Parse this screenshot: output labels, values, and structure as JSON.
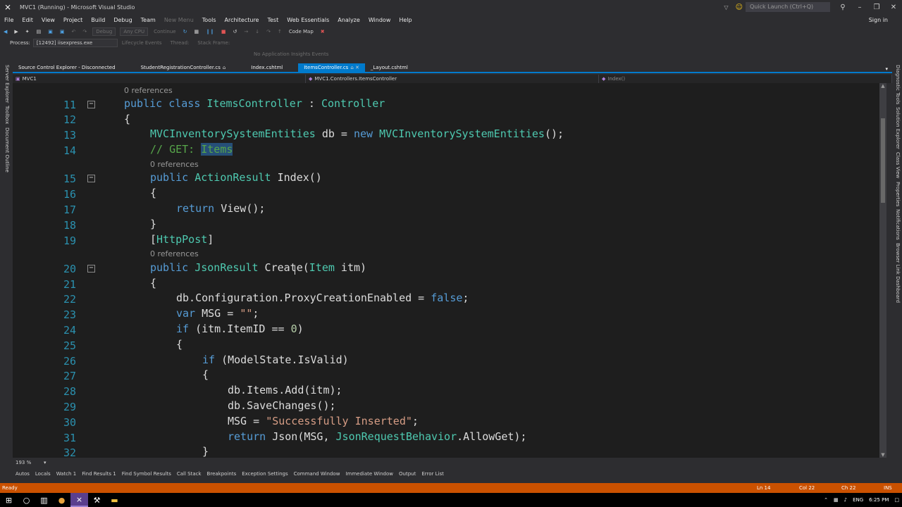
{
  "window": {
    "title": "MVC1 (Running) - Microsoft Visual Studio",
    "quick_launch": "Quick Launch (Ctrl+Q)",
    "sign_in": "Sign in"
  },
  "menu": [
    "File",
    "Edit",
    "View",
    "Project",
    "Build",
    "Debug",
    "Team",
    "New Menu",
    "Tools",
    "Architecture",
    "Test",
    "Web Essentials",
    "Analyze",
    "Window",
    "Help"
  ],
  "toolbar": {
    "debug_combo": "Debug",
    "cpu_combo": "Any CPU",
    "continue": "Continue",
    "code_map": "Code Map"
  },
  "debug_toolbar": {
    "process_label": "Process:",
    "process_value": "[12492] iisexpress.exe",
    "lifecycle": "Lifecycle Events",
    "thread": "Thread:",
    "stack_frame": "Stack Frame:",
    "insights": "No Application Insights Events"
  },
  "left_rail": [
    "Server Explorer",
    "Toolbox",
    "Document Outline"
  ],
  "right_rail": [
    "Diagnostic Tools",
    "Solution Explorer",
    "Class View",
    "Properties",
    "Notifications",
    "Browser Link Dashboard"
  ],
  "doc_tabs": [
    {
      "label": "Source Control Explorer - Disconnected",
      "pin": ""
    },
    {
      "label": "StudentRegistrationController.cs",
      "pin": "⌂"
    },
    {
      "label": "Index.cshtml",
      "pin": ""
    },
    {
      "label": "ItemsController.cs",
      "pin": "⌂ ✕"
    },
    {
      "label": "_Layout.cshtml",
      "pin": ""
    }
  ],
  "nav": {
    "project": "MVC1",
    "class": "MVC1.Controllers.ItemsController",
    "member": "Index()"
  },
  "refs_label": "0 references",
  "code": {
    "l11": {
      "n": "11",
      "a": "public",
      "b": "class",
      "c": "ItemsController",
      "d": ":",
      "e": "Controller"
    },
    "l12": {
      "n": "12",
      "t": "{"
    },
    "l13": {
      "n": "13",
      "a": "MVCInventorySystemEntities",
      "b": " db = ",
      "c": "new",
      "d": "MVCInventorySystemEntities",
      "e": "();"
    },
    "l14": {
      "n": "14",
      "a": "// GET: ",
      "b": "Items"
    },
    "l15": {
      "n": "15",
      "a": "public",
      "b": "ActionResult",
      "c": " Index()"
    },
    "l16": {
      "n": "16",
      "t": "{"
    },
    "l17": {
      "n": "17",
      "a": "return",
      "b": " View();"
    },
    "l18": {
      "n": "18",
      "t": "}"
    },
    "l19": {
      "n": "19",
      "a": "[",
      "b": "HttpPost",
      "c": "]"
    },
    "l20": {
      "n": "20",
      "a": "public",
      "b": "JsonResult",
      "c": " Create(",
      "d": "Item",
      "e": " itm)"
    },
    "l21": {
      "n": "21",
      "t": "{"
    },
    "l22": {
      "n": "22",
      "a": "db.Configuration.ProxyCreationEnabled = ",
      "b": "false",
      "c": ";"
    },
    "l23": {
      "n": "23",
      "a": "var",
      "b": " MSG = ",
      "c": "\"\"",
      "d": ";"
    },
    "l24": {
      "n": "24",
      "a": "if",
      "b": " (itm.ItemID == ",
      "c": "0",
      "d": ")"
    },
    "l25": {
      "n": "25",
      "t": "{"
    },
    "l26": {
      "n": "26",
      "a": "if",
      "b": " (ModelState.IsValid)"
    },
    "l27": {
      "n": "27",
      "t": "{"
    },
    "l28": {
      "n": "28",
      "t": "db.Items.Add(itm);"
    },
    "l29": {
      "n": "29",
      "t": "db.SaveChanges();"
    },
    "l30": {
      "n": "30",
      "a": "MSG = ",
      "b": "\"Successfully Inserted\"",
      "c": ";"
    },
    "l31": {
      "n": "31",
      "a": "return",
      "b": " Json(MSG, ",
      "c": "JsonRequestBehavior",
      "d": ".AllowGet);"
    },
    "l32": {
      "n": "32",
      "t": "}"
    }
  },
  "zoom": "193 %",
  "tool_tabs": [
    "Autos",
    "Locals",
    "Watch 1",
    "Find Results 1",
    "Find Symbol Results",
    "Call Stack",
    "Breakpoints",
    "Exception Settings",
    "Command Window",
    "Immediate Window",
    "Output",
    "Error List"
  ],
  "status": {
    "ready": "Ready",
    "ln": "Ln 14",
    "col": "Col 22",
    "ch": "Ch 22",
    "ins": "INS"
  },
  "taskbar": {
    "lang": "ENG",
    "time": "6:25 PM"
  },
  "colors": {
    "status_bar": "#ca5100",
    "accent": "#007acc",
    "keyword": "#569cd6",
    "type": "#4ec9b0",
    "comment": "#57a64a",
    "string": "#d69d85"
  }
}
